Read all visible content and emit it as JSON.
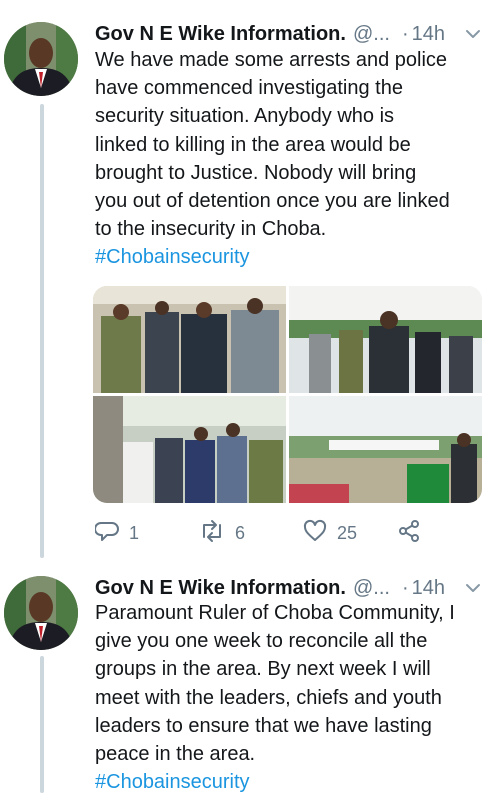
{
  "tweets": [
    {
      "display_name": "Gov N E Wike Information.",
      "handle": "@...",
      "separator": "·",
      "time": "14h",
      "lines": [
        "We have made some arrests and police",
        "have commenced investigating the",
        "security situation.  Anybody  who is",
        "linked to killing in the area would be",
        "brought  to Justice.  Nobody will bring",
        "you out of detention once you are linked",
        "to the insecurity in Choba."
      ],
      "hashtag": "#Chobainsecurity",
      "reply_count": "1",
      "retweet_count": "6",
      "like_count": "25"
    },
    {
      "display_name": "Gov N E Wike Information.",
      "handle": "@...",
      "separator": "·",
      "time": "14h",
      "lines": [
        "Paramount Ruler of Choba Community, I",
        "give you one week to reconcile all the",
        "groups in the area. By next week I will",
        "meet with the leaders, chiefs and youth",
        "leaders to ensure that we have lasting",
        "peace in the area."
      ],
      "hashtag": "#Chobainsecurity"
    }
  ],
  "icons": {
    "avatar": "avatar",
    "caret": "chevron-down-icon",
    "reply": "reply-icon",
    "retweet": "retweet-icon",
    "like": "heart-icon",
    "share": "share-icon"
  },
  "colors": {
    "hashtag": "#1b95e0",
    "muted": "#657786",
    "thread_line": "#ccd6dd"
  }
}
